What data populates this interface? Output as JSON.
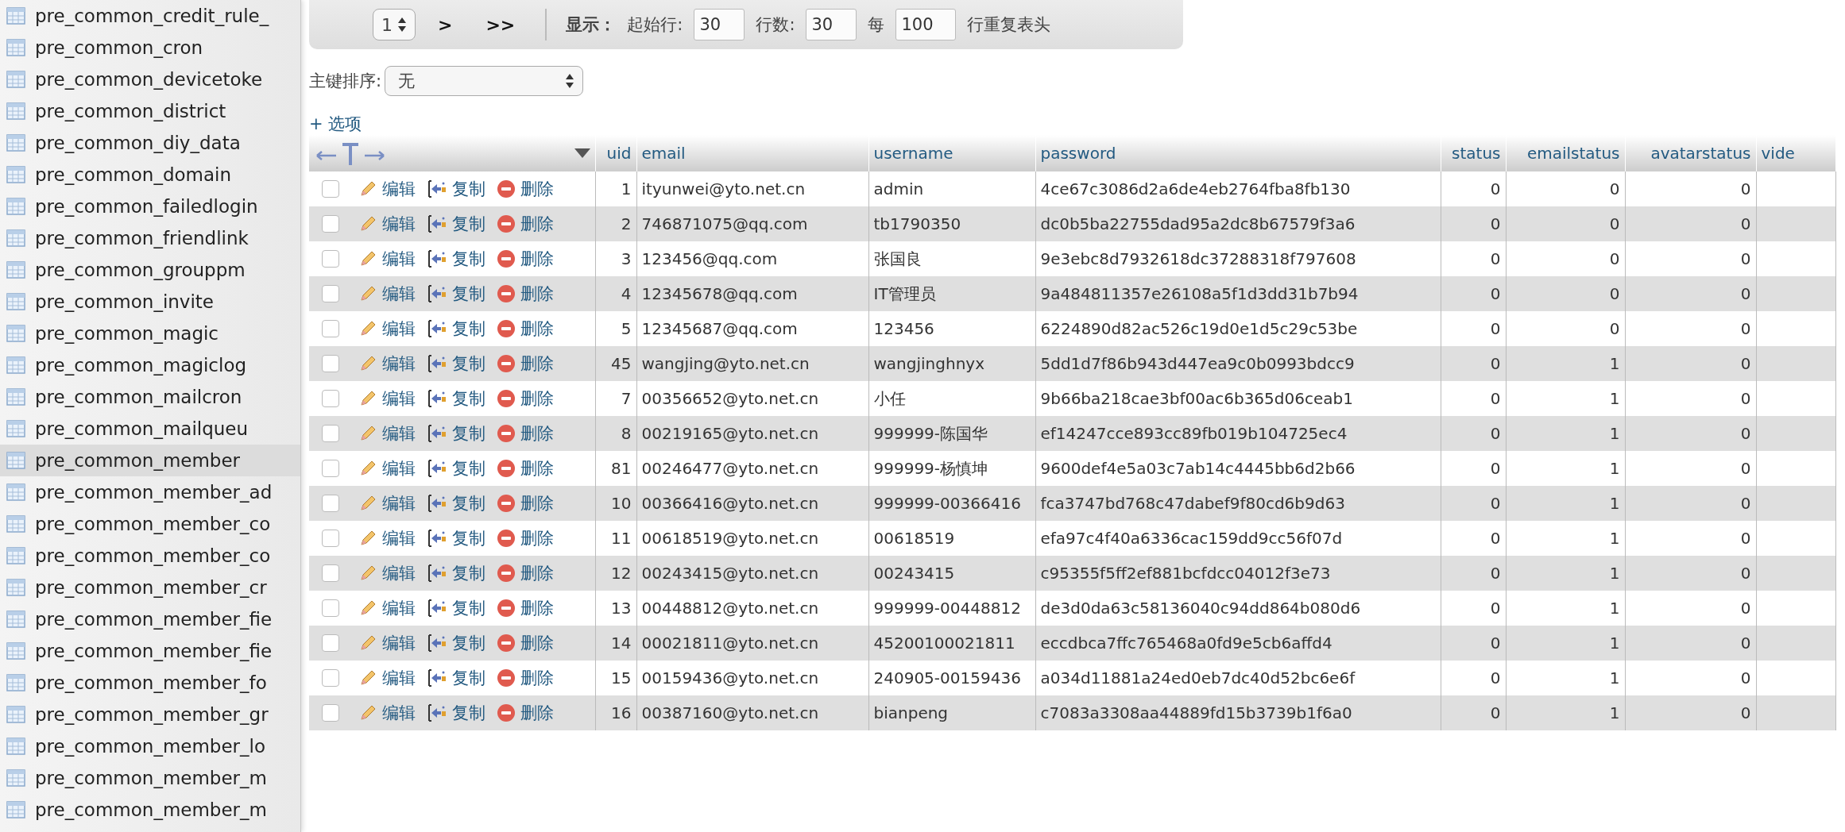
{
  "sidebar": {
    "items": [
      {
        "label": "pre_common_credit_rule_",
        "selected": false
      },
      {
        "label": "pre_common_cron",
        "selected": false
      },
      {
        "label": "pre_common_devicetoke",
        "selected": false
      },
      {
        "label": "pre_common_district",
        "selected": false
      },
      {
        "label": "pre_common_diy_data",
        "selected": false
      },
      {
        "label": "pre_common_domain",
        "selected": false
      },
      {
        "label": "pre_common_failedlogin",
        "selected": false
      },
      {
        "label": "pre_common_friendlink",
        "selected": false
      },
      {
        "label": "pre_common_grouppm",
        "selected": false
      },
      {
        "label": "pre_common_invite",
        "selected": false
      },
      {
        "label": "pre_common_magic",
        "selected": false
      },
      {
        "label": "pre_common_magiclog",
        "selected": false
      },
      {
        "label": "pre_common_mailcron",
        "selected": false
      },
      {
        "label": "pre_common_mailqueu",
        "selected": false
      },
      {
        "label": "pre_common_member",
        "selected": true
      },
      {
        "label": "pre_common_member_ad",
        "selected": false
      },
      {
        "label": "pre_common_member_co",
        "selected": false
      },
      {
        "label": "pre_common_member_co",
        "selected": false
      },
      {
        "label": "pre_common_member_cr",
        "selected": false
      },
      {
        "label": "pre_common_member_fie",
        "selected": false
      },
      {
        "label": "pre_common_member_fie",
        "selected": false
      },
      {
        "label": "pre_common_member_fo",
        "selected": false
      },
      {
        "label": "pre_common_member_gr",
        "selected": false
      },
      {
        "label": "pre_common_member_lo",
        "selected": false
      },
      {
        "label": "pre_common_member_m",
        "selected": false
      },
      {
        "label": "pre_common_member_m",
        "selected": false
      }
    ]
  },
  "toolbar": {
    "page_select": "1",
    "next": ">",
    "last": ">>",
    "display_label": "显示：",
    "start_label": "起始行:",
    "start_value": "30",
    "rows_label": "行数:",
    "rows_value": "30",
    "every_label": "每",
    "every_value": "100",
    "repeat_label": "行重复表头"
  },
  "sort": {
    "label": "主键排序:",
    "value": "无"
  },
  "options_link": "+ 选项",
  "table": {
    "columns": [
      {
        "label": "uid",
        "numeric": true
      },
      {
        "label": "email",
        "numeric": false
      },
      {
        "label": "username",
        "numeric": false
      },
      {
        "label": "password",
        "numeric": false
      },
      {
        "label": "status",
        "numeric": true
      },
      {
        "label": "emailstatus",
        "numeric": true
      },
      {
        "label": "avatarstatus",
        "numeric": true
      },
      {
        "label": "vide",
        "numeric": false
      }
    ],
    "rows": [
      {
        "checked": false,
        "edit": "编辑",
        "copy": "复制",
        "delete": "删除",
        "cells": [
          "1",
          "ityunwei@yto.net.cn",
          "admin",
          "4ce67c3086d2a6de4eb2764fba8fb130",
          "0",
          "0",
          "0"
        ]
      },
      {
        "checked": false,
        "edit": "编辑",
        "copy": "复制",
        "delete": "删除",
        "cells": [
          "2",
          "746871075@qq.com",
          "tb1790350",
          "dc0b5ba22755dad95a2dc8b67579f3a6",
          "0",
          "0",
          "0"
        ]
      },
      {
        "checked": false,
        "edit": "编辑",
        "copy": "复制",
        "delete": "删除",
        "cells": [
          "3",
          "123456@qq.com",
          "张国良",
          "9e3ebc8d7932618dc37288318f797608",
          "0",
          "0",
          "0"
        ]
      },
      {
        "checked": false,
        "edit": "编辑",
        "copy": "复制",
        "delete": "删除",
        "cells": [
          "4",
          "12345678@qq.com",
          "IT管理员",
          "9a484811357e26108a5f1d3dd31b7b94",
          "0",
          "0",
          "0"
        ]
      },
      {
        "checked": false,
        "edit": "编辑",
        "copy": "复制",
        "delete": "删除",
        "cells": [
          "5",
          "12345687@qq.com",
          "123456",
          "6224890d82ac526c19d0e1d5c29c53be",
          "0",
          "0",
          "0"
        ]
      },
      {
        "checked": false,
        "edit": "编辑",
        "copy": "复制",
        "delete": "删除",
        "cells": [
          "45",
          "wangjing@yto.net.cn",
          "wangjinghnyx",
          "5dd1d7f86b943d447ea9c0b0993bdcc9",
          "0",
          "1",
          "0"
        ]
      },
      {
        "checked": false,
        "edit": "编辑",
        "copy": "复制",
        "delete": "删除",
        "cells": [
          "7",
          "00356652@yto.net.cn",
          "小任",
          "9b66ba218cae3bf00ac6b365d06ceab1",
          "0",
          "1",
          "0"
        ]
      },
      {
        "checked": false,
        "edit": "编辑",
        "copy": "复制",
        "delete": "删除",
        "cells": [
          "8",
          "00219165@yto.net.cn",
          "999999-陈国华",
          "ef14247cce893cc89fb019b104725ec4",
          "0",
          "1",
          "0"
        ]
      },
      {
        "checked": false,
        "edit": "编辑",
        "copy": "复制",
        "delete": "删除",
        "cells": [
          "81",
          "00246477@yto.net.cn",
          "999999-杨慎坤",
          "9600def4e5a03c7ab14c4445bb6d2b66",
          "0",
          "1",
          "0"
        ]
      },
      {
        "checked": false,
        "edit": "编辑",
        "copy": "复制",
        "delete": "删除",
        "cells": [
          "10",
          "00366416@yto.net.cn",
          "999999-00366416",
          "fca3747bd768c47dabef9f80cd6b9d63",
          "0",
          "1",
          "0"
        ]
      },
      {
        "checked": false,
        "edit": "编辑",
        "copy": "复制",
        "delete": "删除",
        "cells": [
          "11",
          "00618519@yto.net.cn",
          "00618519",
          "efa97c4f40a6336cac159dd9cc56f07d",
          "0",
          "1",
          "0"
        ]
      },
      {
        "checked": false,
        "edit": "编辑",
        "copy": "复制",
        "delete": "删除",
        "cells": [
          "12",
          "00243415@yto.net.cn",
          "00243415",
          "c95355f5ff2ef881bcfdcc04012f3e73",
          "0",
          "1",
          "0"
        ]
      },
      {
        "checked": false,
        "edit": "编辑",
        "copy": "复制",
        "delete": "删除",
        "cells": [
          "13",
          "00448812@yto.net.cn",
          "999999-00448812",
          "de3d0da63c58136040c94dd864b080d6",
          "0",
          "1",
          "0"
        ]
      },
      {
        "checked": false,
        "edit": "编辑",
        "copy": "复制",
        "delete": "删除",
        "cells": [
          "14",
          "00021811@yto.net.cn",
          "45200100021811",
          "eccdbca7ffc765468a0fd9e5cb6affd4",
          "0",
          "1",
          "0"
        ]
      },
      {
        "checked": false,
        "edit": "编辑",
        "copy": "复制",
        "delete": "删除",
        "cells": [
          "15",
          "00159436@yto.net.cn",
          "240905-00159436",
          "a034d11881a24ed0eb7dc40d52bc6e6f",
          "0",
          "1",
          "0"
        ]
      },
      {
        "checked": false,
        "edit": "编辑",
        "copy": "复制",
        "delete": "删除",
        "cells": [
          "16",
          "00387160@yto.net.cn",
          "bianpeng",
          "c7083a3308aa44889fd15b3739b1f6a0",
          "0",
          "1",
          "0"
        ]
      }
    ]
  }
}
